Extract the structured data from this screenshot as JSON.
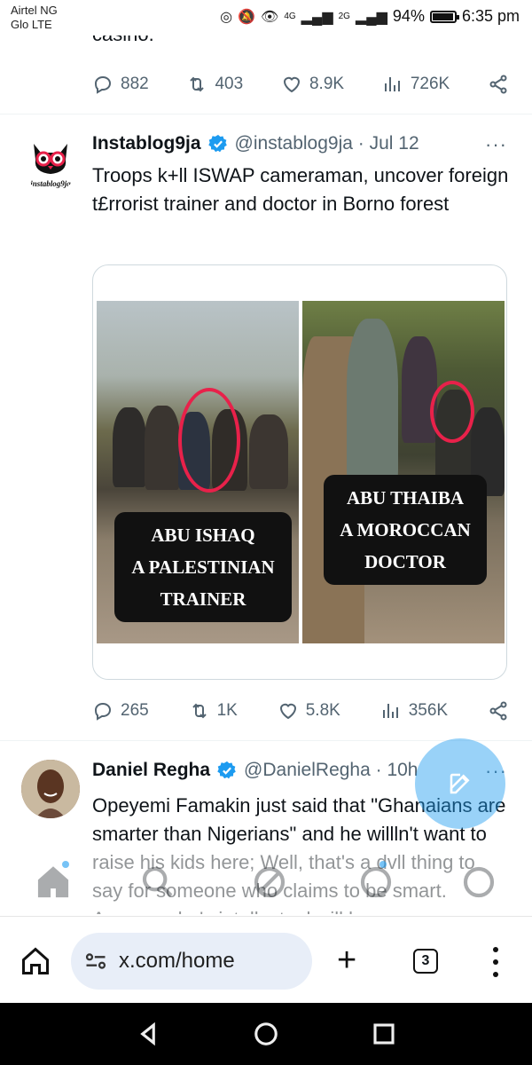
{
  "status_bar": {
    "carrier_line1": "Airtel NG",
    "carrier_line2": "Glo LTE",
    "net1": "4G",
    "net2": "2G",
    "battery_percent": "94%",
    "battery_level": 0.94,
    "time": "6:35 pm"
  },
  "previous_tweet": {
    "tail_text": "casino.",
    "actions": {
      "replies": "882",
      "reposts": "403",
      "likes": "8.9K",
      "views": "726K"
    }
  },
  "tweet1": {
    "avatar_label": "instablog9ja",
    "name": "Instablog9ja",
    "handle": "@instablog9ja · Jul 12",
    "more": "···",
    "text": "Troops k+ll ISWAP cameraman, uncover foreign t£rrorist trainer and doctor in Borno forest",
    "media": {
      "left_caption": [
        "ABU ISHAQ",
        "A PALESTINIAN",
        "TRAINER"
      ],
      "right_caption": [
        "ABU THAIBA",
        "A MOROCCAN",
        "DOCTOR"
      ]
    },
    "actions": {
      "replies": "265",
      "reposts": "1K",
      "likes": "5.8K",
      "views": "356K"
    }
  },
  "tweet2": {
    "name": "Daniel Regha",
    "handle": "@DanielRegha · 10h",
    "more": "···",
    "text": "Opeyemi Famakin just said that \"Ghanaians are smarter than Nigerians\" and he willln't want to raise his kids here; Well, that's a dvll thing to say for someone who claims to be smart. Anyone who's intellectual will know"
  },
  "browser": {
    "url": "x.com/home",
    "tab_count": "3"
  },
  "colors": {
    "accent": "#1d9bf0",
    "verified": "#1d9bf0",
    "circle": "#e8214a"
  }
}
